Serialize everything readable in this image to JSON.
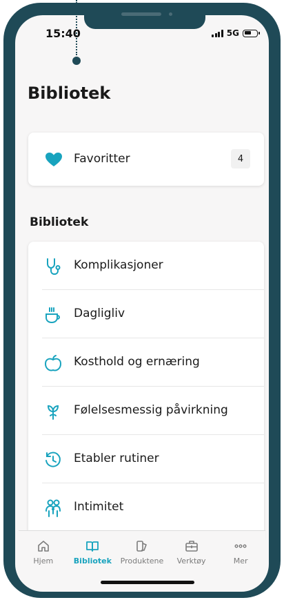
{
  "status_bar": {
    "time": "15:40",
    "network": "5G"
  },
  "page": {
    "title": "Bibliotek"
  },
  "favorites": {
    "label": "Favoritter",
    "count": "4",
    "icon": "heart-icon"
  },
  "library": {
    "section_title": "Bibliotek",
    "items": [
      {
        "label": "Komplikasjoner",
        "icon": "stethoscope-icon"
      },
      {
        "label": "Dagligliv",
        "icon": "coffee-cup-icon"
      },
      {
        "label": "Kosthold og ernæring",
        "icon": "apple-icon"
      },
      {
        "label": "Følelsesmessig påvirkning",
        "icon": "sprout-icon"
      },
      {
        "label": "Etabler rutiner",
        "icon": "clock-refresh-icon"
      },
      {
        "label": "Intimitet",
        "icon": "people-icon"
      }
    ]
  },
  "tab_bar": {
    "active": "Bibliotek",
    "tabs": [
      {
        "label": "Hjem",
        "icon": "home-icon"
      },
      {
        "label": "Bibliotek",
        "icon": "book-icon"
      },
      {
        "label": "Produktene",
        "icon": "products-icon"
      },
      {
        "label": "Verktøy",
        "icon": "toolbox-icon"
      },
      {
        "label": "Mer",
        "icon": "more-icon"
      }
    ]
  },
  "colors": {
    "accent": "#18a3be",
    "frame": "#1f4a57",
    "background": "#f7f6f6"
  }
}
